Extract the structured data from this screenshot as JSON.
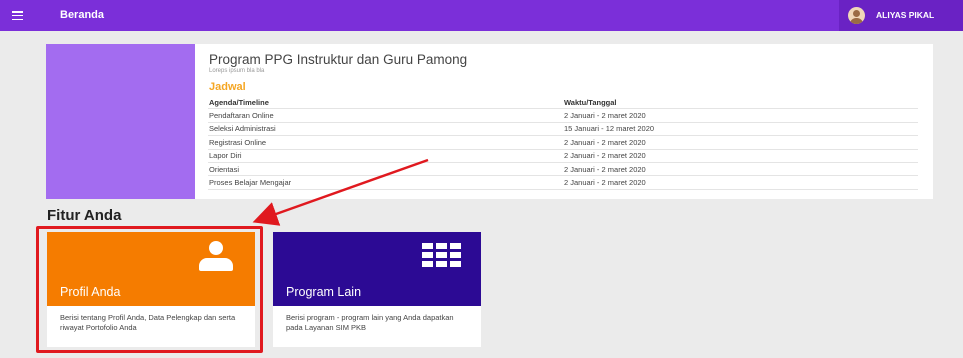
{
  "topbar": {
    "menu_icon": "hamburger-menu-icon",
    "title": "Beranda",
    "user_avatar_icon": "user-avatar-icon",
    "user_name": "ALIYAS PIKAL",
    "color": "#7b2fd9"
  },
  "program": {
    "title": "Program PPG Instruktur dan Guru Pamong",
    "subtitle": "Loreps ipsum bla bla",
    "banner_color": "#a36cf0",
    "jadwal_title": "Jadwal",
    "jadwal_color": "#f5a623",
    "columns": [
      "Agenda/Timeline",
      "Waktu/Tanggal"
    ],
    "rows": [
      {
        "agenda": "Pendaftaran Online",
        "waktu": "2 Januari - 2 maret 2020"
      },
      {
        "agenda": "Seleksi Administrasi",
        "waktu": "15 Januari - 12 maret 2020"
      },
      {
        "agenda": "Registrasi Online",
        "waktu": "2 Januari - 2 maret 2020"
      },
      {
        "agenda": "Lapor Diri",
        "waktu": "2 Januari - 2 maret 2020"
      },
      {
        "agenda": "Orientasi",
        "waktu": "2 Januari - 2 maret 2020"
      },
      {
        "agenda": "Proses Belajar Mengajar",
        "waktu": "2 Januari - 2 maret 2020"
      }
    ]
  },
  "fitur": {
    "title": "Fitur Anda",
    "cards": [
      {
        "label": "Profil Anda",
        "description": "Berisi tentang Profil Anda, Data Pelengkap dan serta riwayat Portofolio Anda",
        "icon": "person-icon",
        "color": "#f57c00"
      },
      {
        "label": "Program Lain",
        "description": "Berisi program - program lain yang Anda dapatkan pada Layanan SIM PKB",
        "icon": "apps-grid-icon",
        "color": "#2c0a94"
      }
    ]
  },
  "annotation": {
    "color": "#e0191f"
  }
}
